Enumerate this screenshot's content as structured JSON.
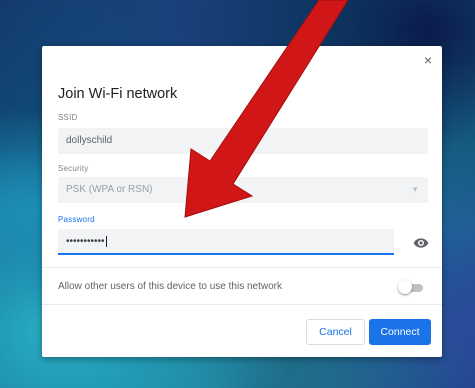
{
  "dialog": {
    "title": "Join Wi-Fi network",
    "close_glyph": "×",
    "ssid": {
      "label": "SSID",
      "value": "dollyschild"
    },
    "security": {
      "label": "Security",
      "value": "PSK (WPA or RSN)",
      "caret": "▼"
    },
    "password": {
      "label": "Password",
      "value": "•••••••••••",
      "toggle_icon": "eye-icon"
    },
    "share": {
      "label": "Allow other users of this device to use this network",
      "enabled": false
    },
    "buttons": {
      "cancel": "Cancel",
      "connect": "Connect"
    }
  },
  "colors": {
    "accent": "#1a73e8",
    "arrow": "#d01616",
    "field_bg": "#f1f3f4"
  }
}
